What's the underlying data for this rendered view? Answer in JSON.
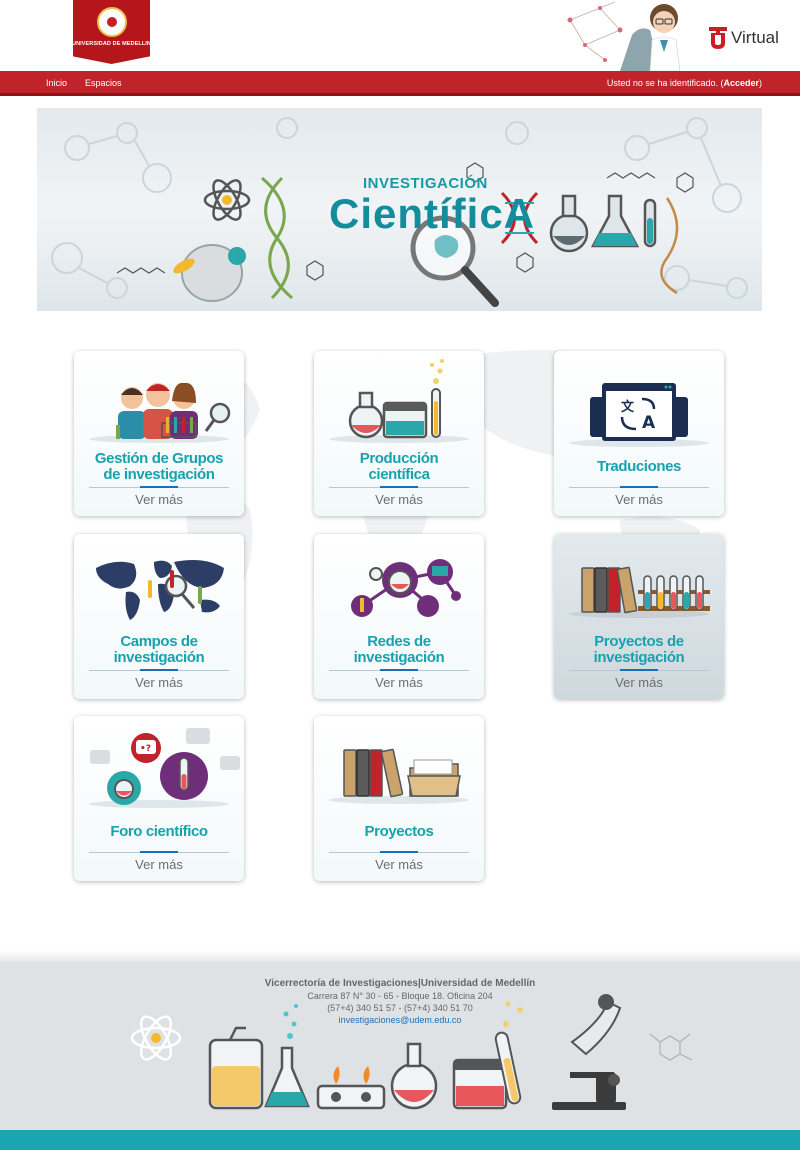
{
  "header": {
    "logo_text": "UNIVERSIDAD DE MEDELLIN",
    "brand_text": "Virtual"
  },
  "nav": {
    "items": [
      {
        "label": "Inicio"
      },
      {
        "label": "Espacios"
      }
    ],
    "login_prefix": "Usted no se ha identificado. (",
    "login_link": "Acceder",
    "login_suffix": ")"
  },
  "banner": {
    "line1": "INVESTIGACIÓN",
    "line2": "CientíficA"
  },
  "cards": [
    {
      "title1": "Gestión de Grupos",
      "title2": "de investigación",
      "more": "Ver más",
      "icon": "people-group-icon"
    },
    {
      "title1": "Producción",
      "title2": "científica",
      "more": "Ver más",
      "icon": "lab-flasks-icon"
    },
    {
      "title1": "Traduciones",
      "title2": "",
      "more": "Ver más",
      "icon": "translate-icon"
    },
    {
      "title1": "Campos de",
      "title2": "investigación",
      "more": "Ver más",
      "icon": "world-map-icon"
    },
    {
      "title1": "Redes de",
      "title2": "investigación",
      "more": "Ver más",
      "icon": "network-icon"
    },
    {
      "title1": "Proyectos de",
      "title2": "investigación",
      "more": "Ver más",
      "icon": "binders-tubes-icon"
    },
    {
      "title1": "Foro científico",
      "title2": "",
      "more": "Ver más",
      "icon": "chat-bubbles-icon"
    },
    {
      "title1": "Proyectos",
      "title2": "",
      "more": "Ver más",
      "icon": "binders-folder-icon"
    }
  ],
  "footer": {
    "title": "Vicerrectoría de Investigaciones|Universidad de Medellín",
    "address": "Carrera 87 N° 30 - 65 - Bloque 18. Oficina 204",
    "phone": "(57+4) 340 51 57 - (57+4) 340 51 70",
    "email": "investigaciones@udem.edu.co"
  },
  "colors": {
    "brand_red": "#c1232a",
    "accent_teal": "#17a2ad",
    "link_blue": "#1a6fb8"
  }
}
